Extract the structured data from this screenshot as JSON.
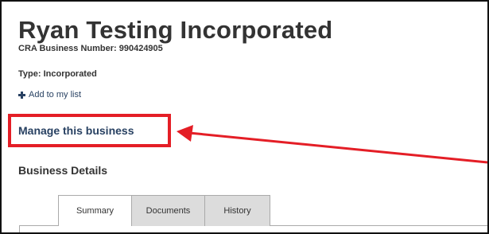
{
  "business": {
    "name": "Ryan Testing Incorporated",
    "cra_number": "CRA Business Number: 990424905",
    "type": "Type: Incorporated",
    "add_to_list": "Add to my list",
    "manage": "Manage this business",
    "details_heading": "Business Details"
  },
  "tabs": [
    {
      "label": "Summary",
      "active": true
    },
    {
      "label": "Documents",
      "active": false
    },
    {
      "label": "History",
      "active": false
    }
  ],
  "icons": {
    "add": "plus-icon",
    "annotation": "red-arrow-icon"
  },
  "colors": {
    "link": "#284162",
    "annotation": "#e41e26",
    "tab_inactive": "#dcdcdc"
  }
}
